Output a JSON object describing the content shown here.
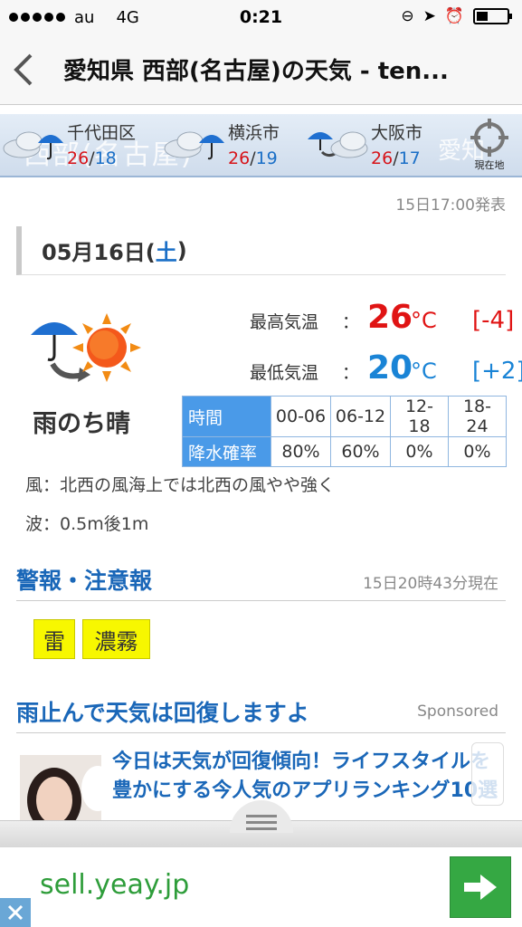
{
  "status_bar": {
    "carrier": "au",
    "network": "4G",
    "time": "0:21"
  },
  "nav": {
    "title": "愛知県 西部(名古屋)の天気 - ten..."
  },
  "city_strip": {
    "bg_text": "西部(名古屋)",
    "bg_text_right": "愛知",
    "cities": [
      {
        "name": "千代田区",
        "high": "26",
        "low": "18",
        "icon": "rain-umbrella-cloud"
      },
      {
        "name": "横浜市",
        "high": "26",
        "low": "19",
        "icon": "rain-umbrella-cloud"
      },
      {
        "name": "大阪市",
        "high": "26",
        "low": "17",
        "icon": "rain-then-cloud"
      }
    ],
    "locate_label": "現在地"
  },
  "announce": "15日17:00発表",
  "forecast": {
    "date": "05月16日(",
    "dow": "土",
    "date_close": ")",
    "weather": "雨のち晴",
    "high": {
      "label": "最高気温",
      "colon": "：",
      "value": "26",
      "unit": "°C",
      "diff": "[-4]"
    },
    "low": {
      "label": "最低気温",
      "colon": "：",
      "value": "20",
      "unit": "°C",
      "diff": "[+2]"
    },
    "rain_table": {
      "header_time": "時間",
      "header_prob": "降水確率",
      "slots": [
        "00-06",
        "06-12",
        "12-18",
        "18-24"
      ],
      "probs": [
        "80%",
        "60%",
        "0%",
        "0%"
      ]
    },
    "wind": "風：北西の風海上では北西の風やや強く",
    "wave": "波：0.5m後1m"
  },
  "warnings": {
    "title": "警報・注意報",
    "time": "15日20時43分現在",
    "items": [
      "雷",
      "濃霧"
    ]
  },
  "sponsored": {
    "title": "雨止んで天気は回復しますよ",
    "label": "Sponsored",
    "ad_text": "今日は天気が回復傾向！ライフスタイルを豊かにする今人気のアプリランキング10選"
  },
  "banner": {
    "text": "sell.yeay.jp"
  },
  "colors": {
    "accent_blue": "#1a67b8",
    "high_red": "#e01414",
    "low_blue": "#1a84d6",
    "warning_yellow": "#f7f700",
    "banner_green": "#35a843"
  }
}
